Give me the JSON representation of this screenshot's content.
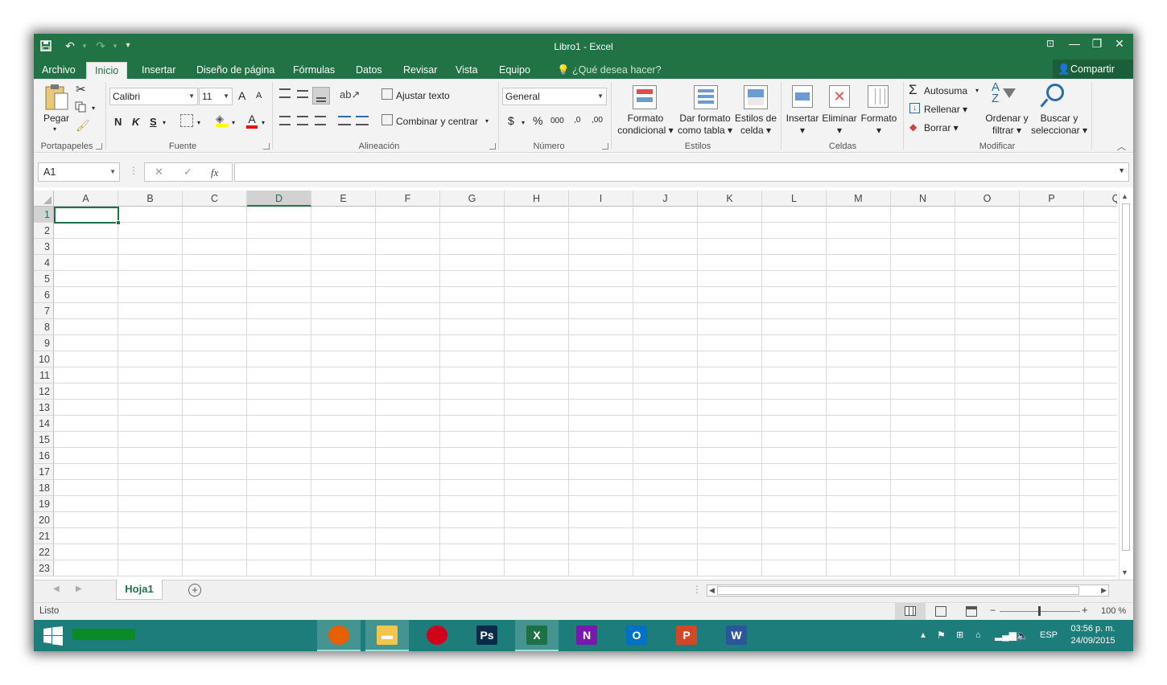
{
  "window": {
    "title": "Libro1 - Excel"
  },
  "qat": {
    "save": "save-icon",
    "undo": "↶",
    "redo": "↷",
    "customize": "▾"
  },
  "window_controls": {
    "ribbon_display": "⊡",
    "minimize": "—",
    "restore": "❐",
    "close": "✕"
  },
  "tabs": [
    "Archivo",
    "Inicio",
    "Insertar",
    "Diseño de página",
    "Fórmulas",
    "Datos",
    "Revisar",
    "Vista",
    "Equipo"
  ],
  "tell_me": "¿Qué desea hacer?",
  "share": "Compartir",
  "ribbon": {
    "clipboard": {
      "paste": "Pegar",
      "label": "Portapapeles"
    },
    "font": {
      "name": "Calibri",
      "size": "11",
      "bold": "N",
      "italic": "K",
      "underline": "S",
      "label": "Fuente",
      "grow": "A",
      "shrink": "A",
      "font_color": "A"
    },
    "alignment": {
      "wrap": "Ajustar texto",
      "merge": "Combinar y centrar",
      "label": "Alineación"
    },
    "number": {
      "format": "General",
      "currency": "$",
      "percent": "%",
      "thousands": "000",
      "inc_decimals": ",0",
      "dec_decimals": ",00",
      "label": "Número"
    },
    "styles": {
      "conditional_1": "Formato",
      "conditional_2": "condicional",
      "table_1": "Dar formato",
      "table_2": "como tabla",
      "cell_1": "Estilos de",
      "cell_2": "celda",
      "label": "Estilos"
    },
    "cells": {
      "insert": "Insertar",
      "delete": "Eliminar",
      "format": "Formato",
      "label": "Celdas"
    },
    "editing": {
      "autosum": "Autosuma",
      "fill": "Rellenar",
      "clear": "Borrar",
      "sort_1": "Ordenar y",
      "sort_2": "filtrar",
      "find_1": "Buscar y",
      "find_2": "seleccionar",
      "label": "Modificar"
    }
  },
  "formula_bar": {
    "name_box": "A1",
    "cancel": "✕",
    "enter": "✓",
    "fx": "fx",
    "value": ""
  },
  "grid": {
    "columns": [
      "A",
      "B",
      "C",
      "D",
      "E",
      "F",
      "G",
      "H",
      "I",
      "J",
      "K",
      "L",
      "M",
      "N",
      "O",
      "P",
      "Q"
    ],
    "rows": [
      "1",
      "2",
      "3",
      "4",
      "5",
      "6",
      "7",
      "8",
      "9",
      "10",
      "11",
      "12",
      "13",
      "14",
      "15",
      "16",
      "17",
      "18",
      "19",
      "20",
      "21",
      "22",
      "23"
    ],
    "active_cell": "A1",
    "highlighted_column": "D"
  },
  "sheets": {
    "tabs": [
      "Hoja1"
    ],
    "add": "+"
  },
  "status": {
    "ready": "Listo",
    "zoom": "100 %"
  },
  "taskbar": {
    "apps": [
      {
        "name": "Firefox",
        "glyph": "●",
        "color": "#e66000"
      },
      {
        "name": "Explorador",
        "glyph": "▬",
        "color": "#f2c54c"
      },
      {
        "name": "Grabar",
        "glyph": "●",
        "color": "#d0021b"
      },
      {
        "name": "Photoshop",
        "glyph": "Ps",
        "color": "#0a2a4a"
      },
      {
        "name": "Excel",
        "glyph": "X",
        "color": "#1e7145"
      },
      {
        "name": "OneNote",
        "glyph": "N",
        "color": "#7719aa"
      },
      {
        "name": "Outlook",
        "glyph": "O",
        "color": "#0072c6"
      },
      {
        "name": "PowerPoint",
        "glyph": "P",
        "color": "#d24726"
      },
      {
        "name": "Word",
        "glyph": "W",
        "color": "#2b579a"
      }
    ],
    "language": "ESP",
    "time": "03:56 p. m.",
    "date": "24/09/2015"
  }
}
